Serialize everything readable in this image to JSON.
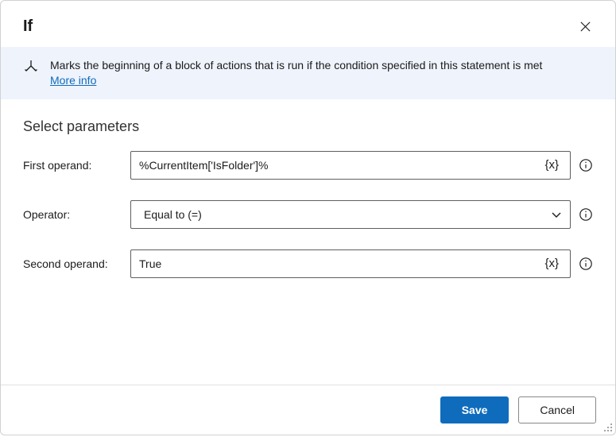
{
  "header": {
    "title": "If"
  },
  "banner": {
    "text": "Marks the beginning of a block of actions that is run if the condition specified in this statement is met",
    "link_label": "More info"
  },
  "section": {
    "title": "Select parameters"
  },
  "fields": {
    "first_operand": {
      "label": "First operand:",
      "value": "%CurrentItem['IsFolder']%"
    },
    "operator": {
      "label": "Operator:",
      "value": "Equal to (=)"
    },
    "second_operand": {
      "label": "Second operand:",
      "value": "True"
    }
  },
  "footer": {
    "save_label": "Save",
    "cancel_label": "Cancel"
  },
  "icons": {
    "variable_label": "{x}"
  }
}
